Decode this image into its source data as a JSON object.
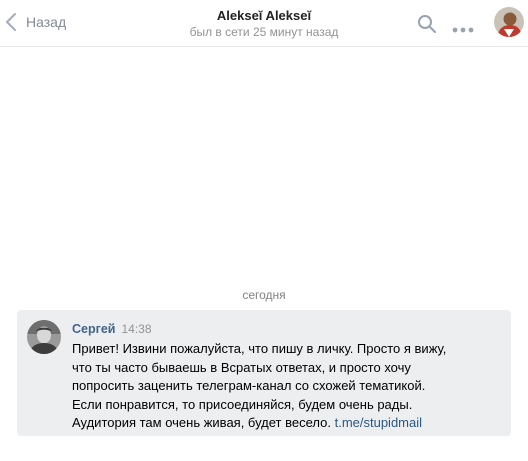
{
  "header": {
    "back_label": "Назад",
    "title": "Alekseĭ Alekseĭ",
    "status": "был в сети 25 минут назад"
  },
  "date_separator": "сегодня",
  "message": {
    "author": "Сергей",
    "time": "14:38",
    "lines": [
      "Привет! Извини пожалуйста, что пишу в личку. Просто я вижу,",
      "что ты часто бываешь в Всратых ответах, и просто хочу",
      "попросить заценить телеграм-канал со схожей тематикой.",
      "Если понравится, то присоединяйся, будем очень рады."
    ],
    "last_line_text": "Аудитория там очень живая, будет весело. ",
    "link": "t.me/stupidmail"
  },
  "colors": {
    "accent": "#42648b",
    "link": "#2a5885",
    "message_bg": "#edeef0",
    "muted": "#828a99"
  },
  "icons": {
    "back": "chevron-left-icon",
    "search": "search-icon",
    "more": "more-dots-icon"
  }
}
